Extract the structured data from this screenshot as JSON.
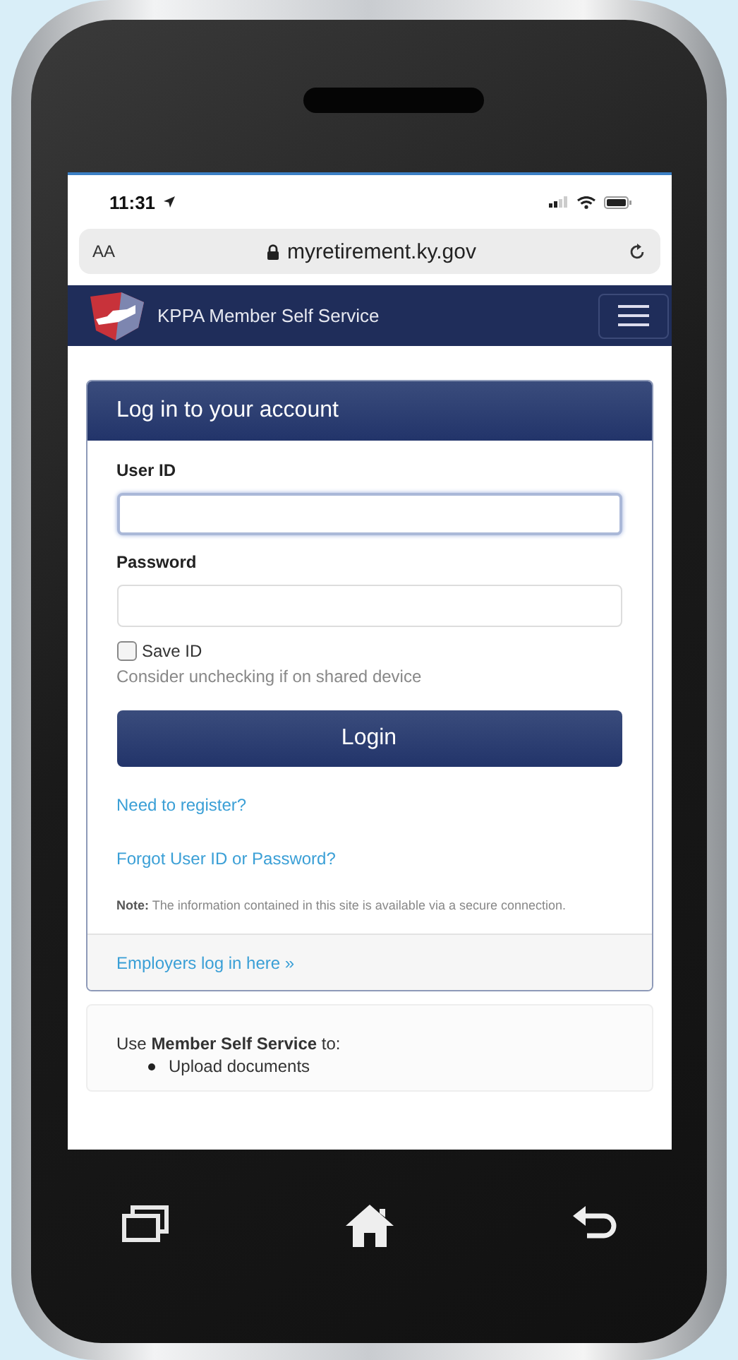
{
  "status_bar": {
    "time": "11:31"
  },
  "address_bar": {
    "text_size": "AA",
    "url": "myretirement.ky.gov"
  },
  "header": {
    "brand": "KPPA Member Self Service"
  },
  "login_card": {
    "title": "Log in to your account",
    "fields": [
      {
        "label": "User ID",
        "focused": true
      },
      {
        "label": "Password",
        "focused": false
      }
    ],
    "checkbox": {
      "label": "Save ID",
      "checked": false
    },
    "hint": "Consider unchecking if on shared device",
    "button": "Login",
    "links": [
      "Need to register?",
      "Forgot User ID or Password?"
    ],
    "note": "**Note:** The information contained in this site is available via a secure connection.",
    "footer_link": "Employers log in here »"
  },
  "info_panel": {
    "intro": "Use **Member Self Service** to:",
    "items": [
      "Upload documents"
    ]
  }
}
